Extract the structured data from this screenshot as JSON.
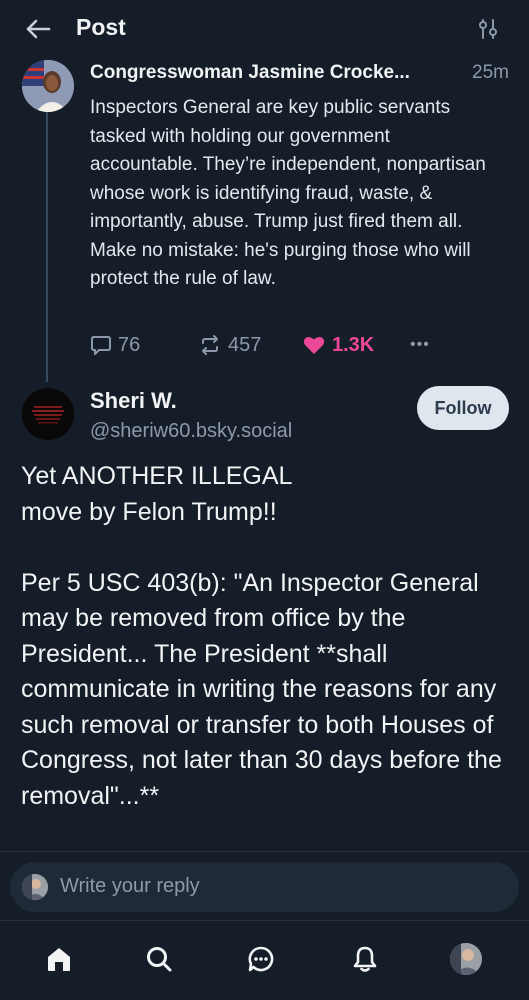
{
  "header": {
    "title": "Post",
    "back_icon": "arrow-left-icon",
    "filter_icon": "sliders-icon"
  },
  "parent_post": {
    "author": "Congresswoman Jasmine Crocke...",
    "time": "25m",
    "text": "Inspectors General are key public servants tasked with holding our government accountable. They’re independent, nonpartisan whose work is identifying fraud, waste, & importantly, abuse. Trump just fired them all. Make no mistake: he's purging those who will protect the rule of law.",
    "replies": "76",
    "reposts": "457",
    "likes": "1.3K",
    "more_label": "•••"
  },
  "main_post": {
    "author": "Sheri W.",
    "handle": "@sheriw60.bsky.social",
    "follow_label": "Follow",
    "text": "Yet ANOTHER ILLEGAL\nmove by Felon Trump!!\n\nPer 5 USC 403(b):  \"An Inspector General may be removed from office by the President... The President **shall communicate in writing the reasons for any such removal or transfer to both Houses of Congress, not later than 30 days before the removal\"...**"
  },
  "reply_box": {
    "placeholder": "Write your reply"
  },
  "nav": {
    "items": [
      "home-icon",
      "search-icon",
      "chat-icon",
      "bell-icon",
      "profile-avatar"
    ]
  },
  "colors": {
    "background": "#151d28",
    "like": "#ec4899",
    "muted": "#8d99ab",
    "follow_bg": "#dfe6ee"
  }
}
